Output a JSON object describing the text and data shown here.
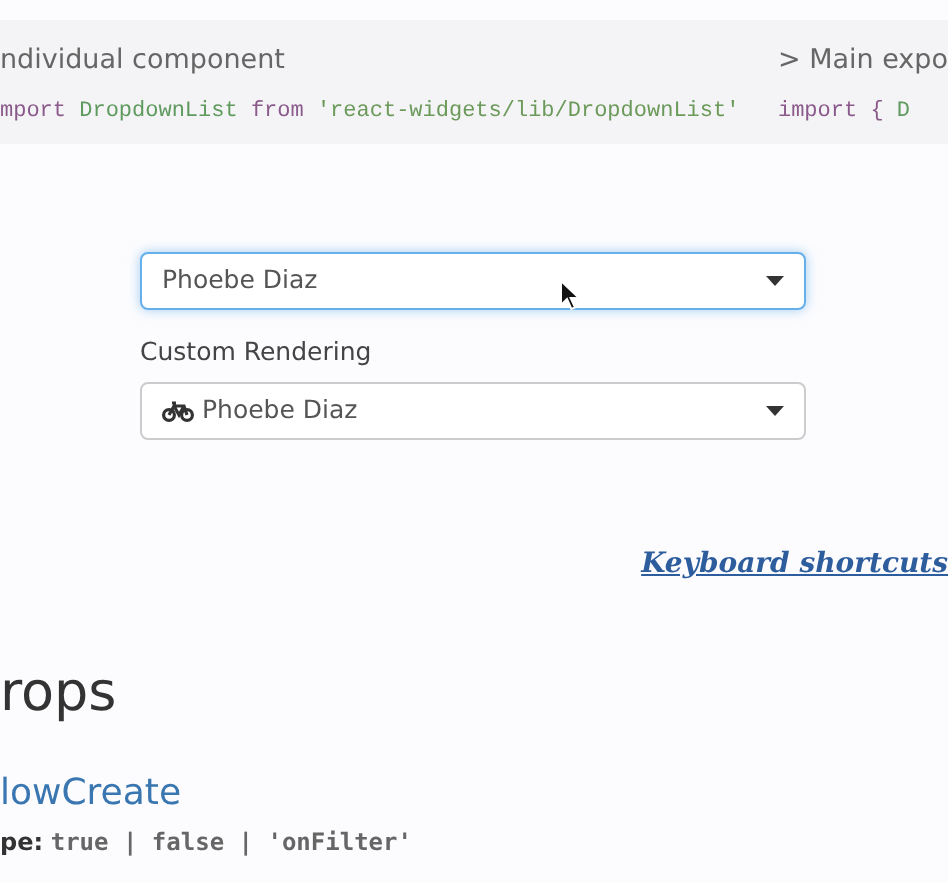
{
  "import_panel": {
    "columns": [
      {
        "heading": "ndividual component",
        "code": [
          {
            "kind": "keyword",
            "text": "mport"
          },
          {
            "kind": "identifier",
            "text": "DropdownList"
          },
          {
            "kind": "keyword",
            "text": "from"
          },
          {
            "kind": "string",
            "text": "'react-widgets/lib/DropdownList'"
          }
        ]
      },
      {
        "heading": "> Main expo",
        "code": [
          {
            "kind": "keyword",
            "text": "import"
          },
          {
            "kind": "punct",
            "text": "{"
          },
          {
            "kind": "identifier",
            "text": "D"
          }
        ]
      }
    ]
  },
  "dropdowns": [
    {
      "kind": "plain",
      "value": "Phoebe Diaz",
      "focused": true
    },
    {
      "kind": "with-icon",
      "label": "Custom Rendering",
      "value": "Phoebe Diaz",
      "focused": false
    }
  ],
  "shortcuts_link": "Keyboard shortcuts",
  "props": {
    "heading": "rops",
    "items": [
      {
        "name": "lowCreate",
        "type_label": "pe:",
        "type_value": "true | false | 'onFilter'"
      }
    ]
  }
}
